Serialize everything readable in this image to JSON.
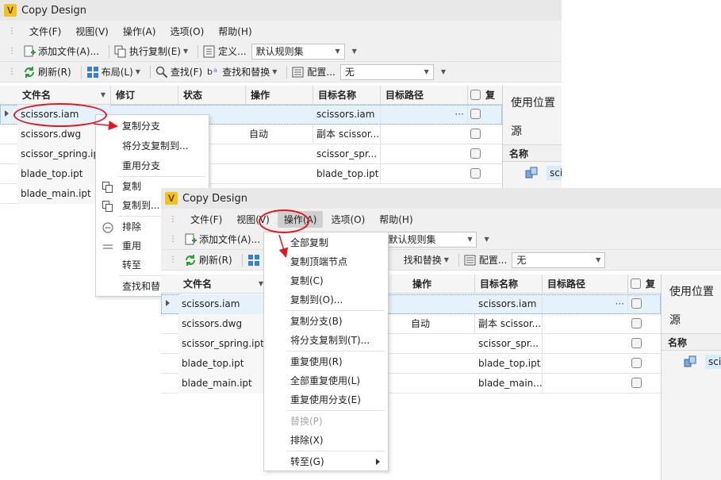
{
  "app": {
    "title": "Copy Design",
    "logo_letter": "V"
  },
  "menu": [
    "文件(F)",
    "视图(V)",
    "操作(A)",
    "选项(O)",
    "帮助(H)"
  ],
  "toolbar1": {
    "add_files": "添加文件(A)...",
    "execute_copy": "执行复制(E)",
    "define": "定义...",
    "rule_set": "默认规则集"
  },
  "toolbar2": {
    "refresh": "刷新(R)",
    "layout": "布局(L)",
    "find": "查找(F)",
    "find_replace": "查找和替换",
    "config": "配置...",
    "filter": "无"
  },
  "columns": [
    "文件名",
    "修订",
    "状态",
    "操作",
    "目标名称",
    "目标路径",
    "复"
  ],
  "rows": [
    {
      "file": "scissors.iam",
      "action": "",
      "target": "scissors.iam"
    },
    {
      "file": "scissors.dwg",
      "action": "自动",
      "target": "副本 scissor..."
    },
    {
      "file": "scissor_spring.ipt",
      "action": "",
      "target": "scissor_spr..."
    },
    {
      "file": "blade_top.ipt",
      "action": "",
      "target": "blade_top.ipt"
    },
    {
      "file": "blade_main.ipt",
      "action": "",
      "target": "blade_main..."
    }
  ],
  "win1_targets": [
    "scissors.iam",
    "副本 scissor...",
    "scissor_spr...",
    "blade_top.ipt"
  ],
  "ellipsis": "···",
  "panel": {
    "title": "使用位置",
    "source": "源",
    "name_col": "名称",
    "item": "scis"
  },
  "context_menu_1": {
    "items": [
      "复制分支",
      "将分支复制到...",
      "重用分支",
      "复制",
      "复制到...",
      "排除",
      "重用",
      "转至",
      "查找和替"
    ]
  },
  "context_menu_2": {
    "items": [
      "全部复制",
      "复制顶端节点",
      "复制(C)",
      "复制到(O)...",
      "复制分支(B)",
      "将分支复制到(T)...",
      "重复使用(R)",
      "全部重复使用(L)",
      "重复使用分支(E)",
      "替换(P)",
      "排除(X)",
      "转至(G)"
    ]
  },
  "colors": {
    "callout": "#e4161c",
    "selection": "#e5f1fb",
    "logo": "#f3c21c"
  }
}
